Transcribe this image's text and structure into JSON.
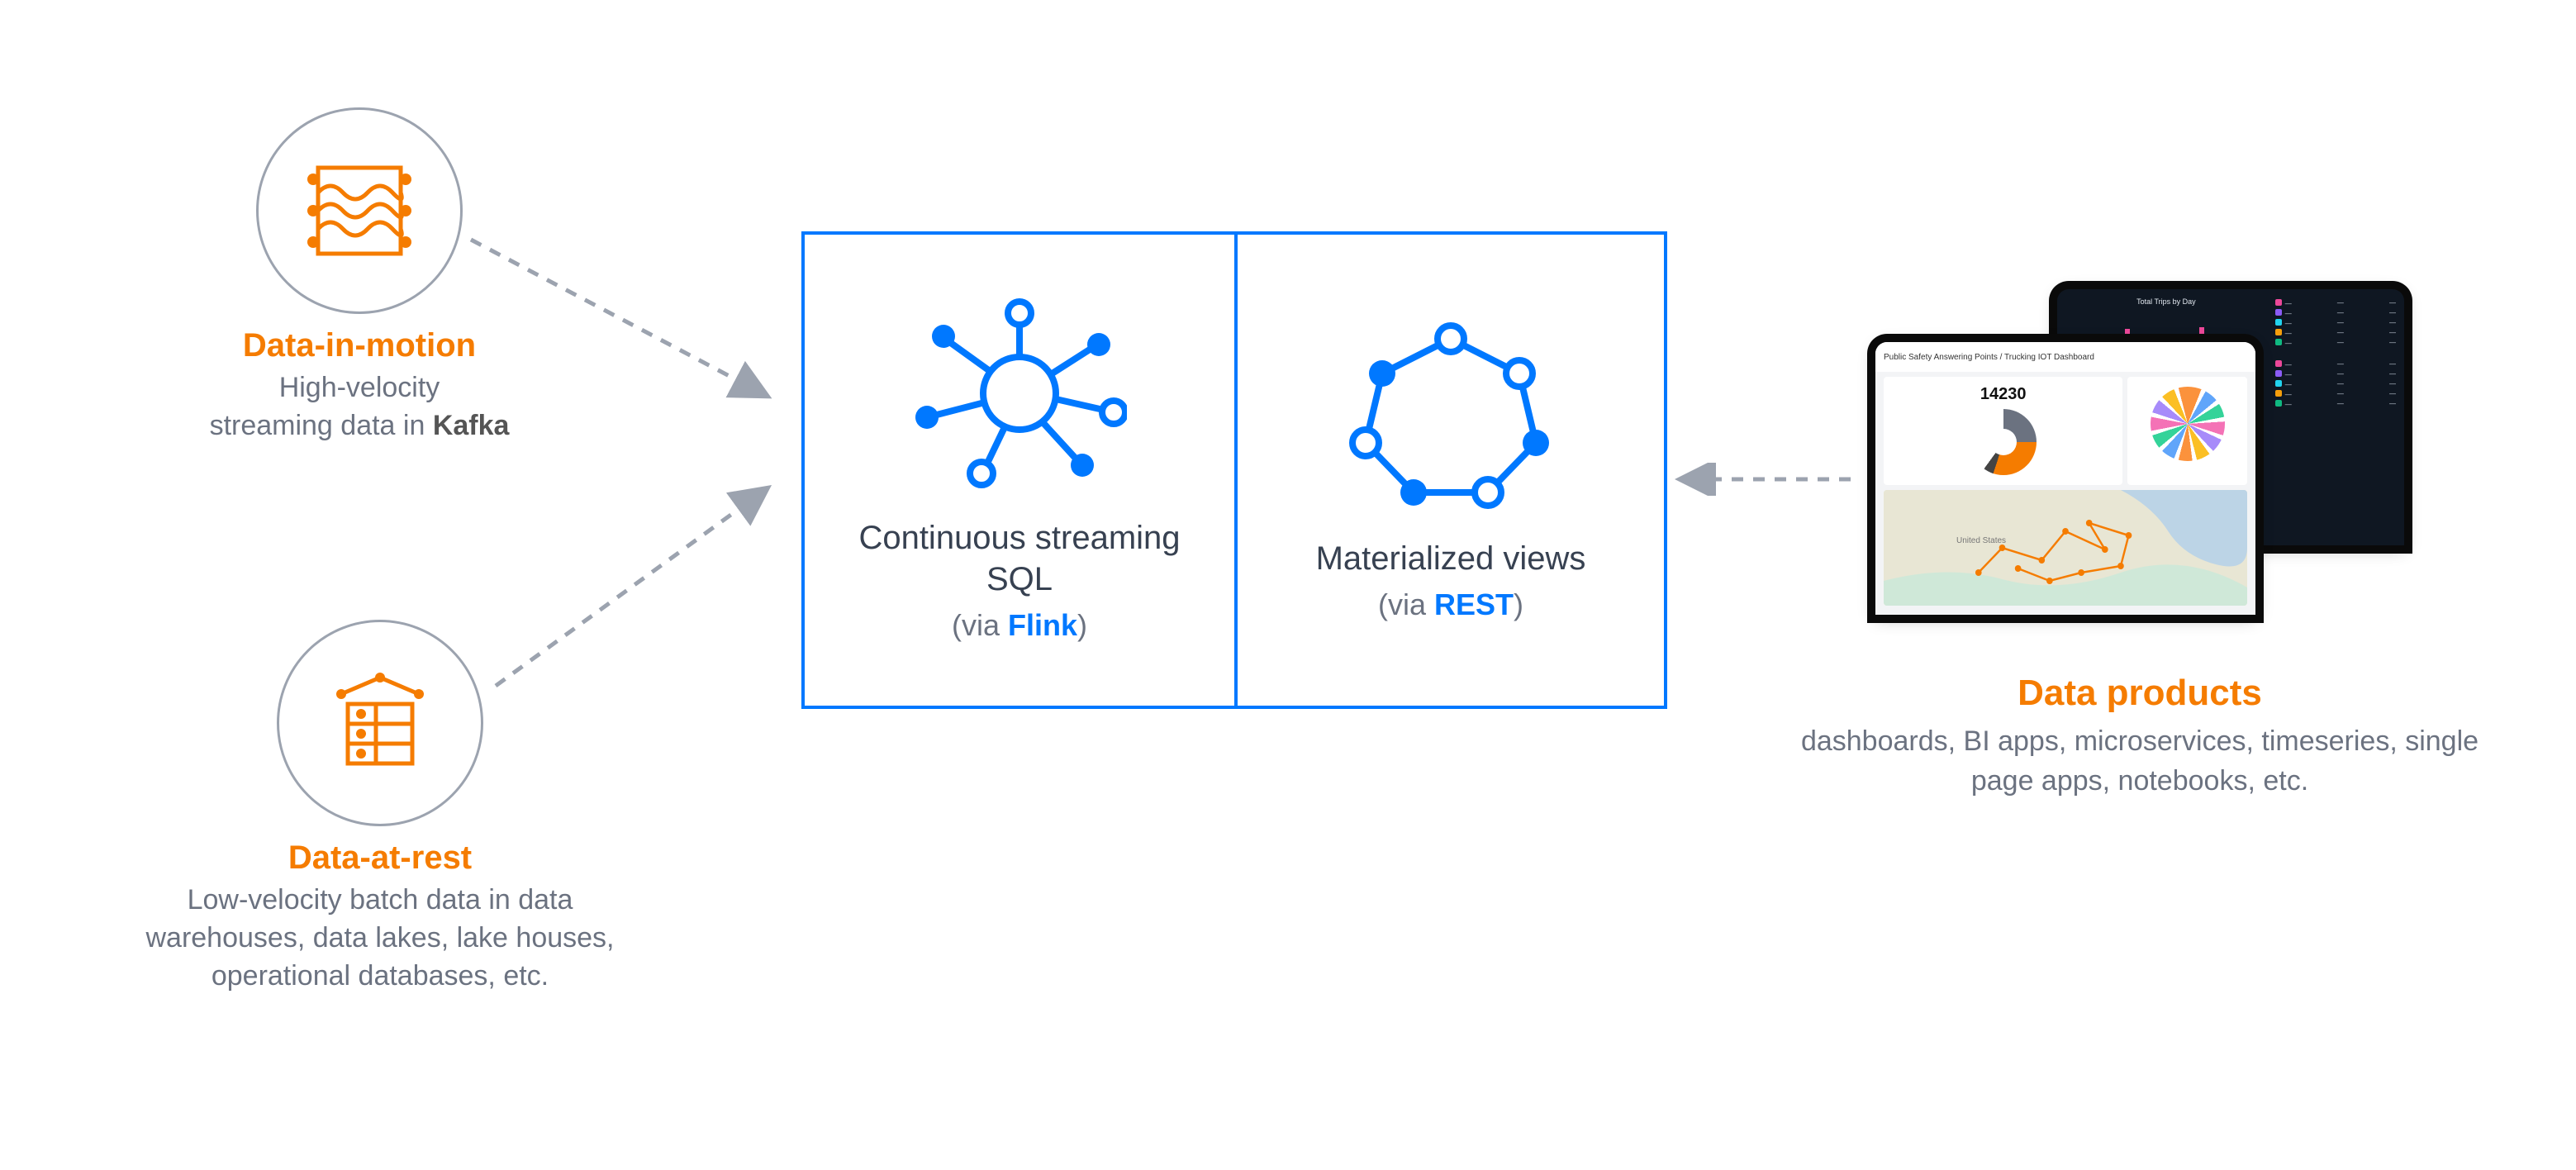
{
  "left": {
    "motion": {
      "title": "Data-in-motion",
      "desc_line1": "High-velocity",
      "desc_line2_pre": "streaming data in ",
      "desc_line2_bold": "Kafka"
    },
    "rest": {
      "title": "Data-at-rest",
      "desc": "Low-velocity batch data in data warehouses, data lakes, lake houses, operational databases, etc."
    }
  },
  "center": {
    "left_box": {
      "title": "Continuous streaming SQL",
      "sub_pre": "(via ",
      "sub_link": "Flink",
      "sub_post": ")"
    },
    "right_box": {
      "title": "Materialized views",
      "sub_pre": "(via ",
      "sub_link": "REST",
      "sub_post": ")"
    }
  },
  "right": {
    "title": "Data products",
    "desc": "dashboards, BI apps, microservices, timeseries, single page apps, notebooks, etc.",
    "laptop_front": {
      "header": "Public Safety Answering Points / Trucking IOT Dashboard",
      "kpi_value": "14230",
      "map_label": "United States"
    },
    "laptop_back": {
      "title": "Total Trips by Day"
    }
  }
}
